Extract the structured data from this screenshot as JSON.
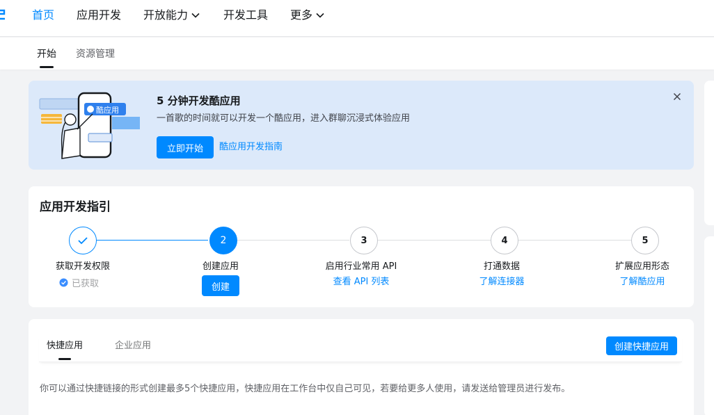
{
  "topnav": {
    "items": [
      {
        "label": "首页",
        "active": true
      },
      {
        "label": "应用开发"
      },
      {
        "label": "开放能力",
        "has_dropdown": true
      },
      {
        "label": "开发工具"
      },
      {
        "label": "更多",
        "has_dropdown": true
      }
    ]
  },
  "subnav": {
    "tabs": [
      {
        "label": "开始",
        "active": true
      },
      {
        "label": "资源管理"
      }
    ]
  },
  "banner": {
    "title": "5 分钟开发酷应用",
    "description": "一首歌的时间就可以开发一个酷应用，进入群聊沉浸式体验应用",
    "primary_button": "立即开始",
    "link": "酷应用开发指南",
    "illustration_tag": "酷应用",
    "close_icon": "close-icon"
  },
  "guide": {
    "title": "应用开发指引",
    "steps": [
      {
        "number": "✓",
        "label": "获取开发权限",
        "status_text": "已获取",
        "state": "done"
      },
      {
        "number": "2",
        "label": "创建应用",
        "action_button": "创建",
        "state": "current"
      },
      {
        "number": "3",
        "label": "启用行业常用 API",
        "link": "查看 API 列表",
        "state": "pending"
      },
      {
        "number": "4",
        "label": "打通数据",
        "link": "了解连接器",
        "state": "pending"
      },
      {
        "number": "5",
        "label": "扩展应用形态",
        "link": "了解酷应用",
        "state": "pending"
      }
    ]
  },
  "quick_apps": {
    "tabs": [
      {
        "label": "快捷应用",
        "active": true
      },
      {
        "label": "企业应用"
      }
    ],
    "create_button": "创建快捷应用",
    "description": "你可以通过快捷链接的形式创建最多5个快捷应用，快捷应用在工作台中仅自己可见，若要给更多人使用，请发送给管理员进行发布。"
  },
  "colors": {
    "accent": "#0089ff",
    "banner_bg": "#dce9fa",
    "page_bg": "#f2f3f5"
  }
}
